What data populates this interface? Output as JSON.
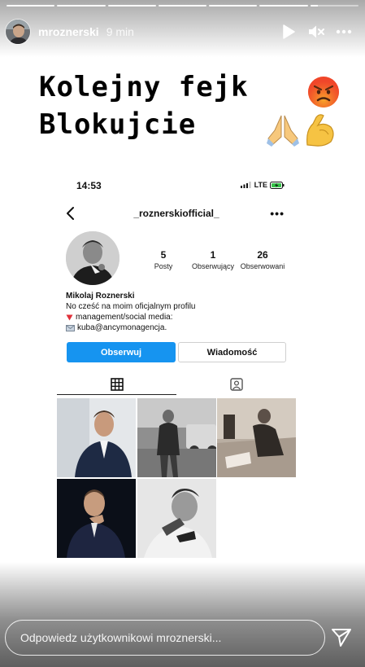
{
  "story": {
    "username": "mroznerski",
    "time_ago": "9 min",
    "progress_segments": 7,
    "progress_current_fraction": 0.15,
    "caption_line1": "Kolejny fejk",
    "caption_line2": "Blokujcie",
    "emoji": [
      "angry-face",
      "folded-hands",
      "flexed-biceps"
    ]
  },
  "screenshot": {
    "status_time": "14:53",
    "network": "LTE",
    "profile_handle": "_roznerskiofficial_",
    "stats": [
      {
        "num": "5",
        "label": "Posty"
      },
      {
        "num": "1",
        "label": "Obserwujący"
      },
      {
        "num": "26",
        "label": "Obserwowani"
      }
    ],
    "name": "Mikolaj Roznerski",
    "bio_line1": "No cześć na moim oficjalnym profilu",
    "bio_line2": "management/social media:",
    "bio_line3": "kuba@ancymonagencja.",
    "follow_label": "Obserwuj",
    "message_label": "Wiadomość"
  },
  "reply": {
    "placeholder": "Odpowiedz użytkownikowi mroznerski..."
  },
  "colors": {
    "follow_button": "#1694f0",
    "background": "#ffffff"
  }
}
